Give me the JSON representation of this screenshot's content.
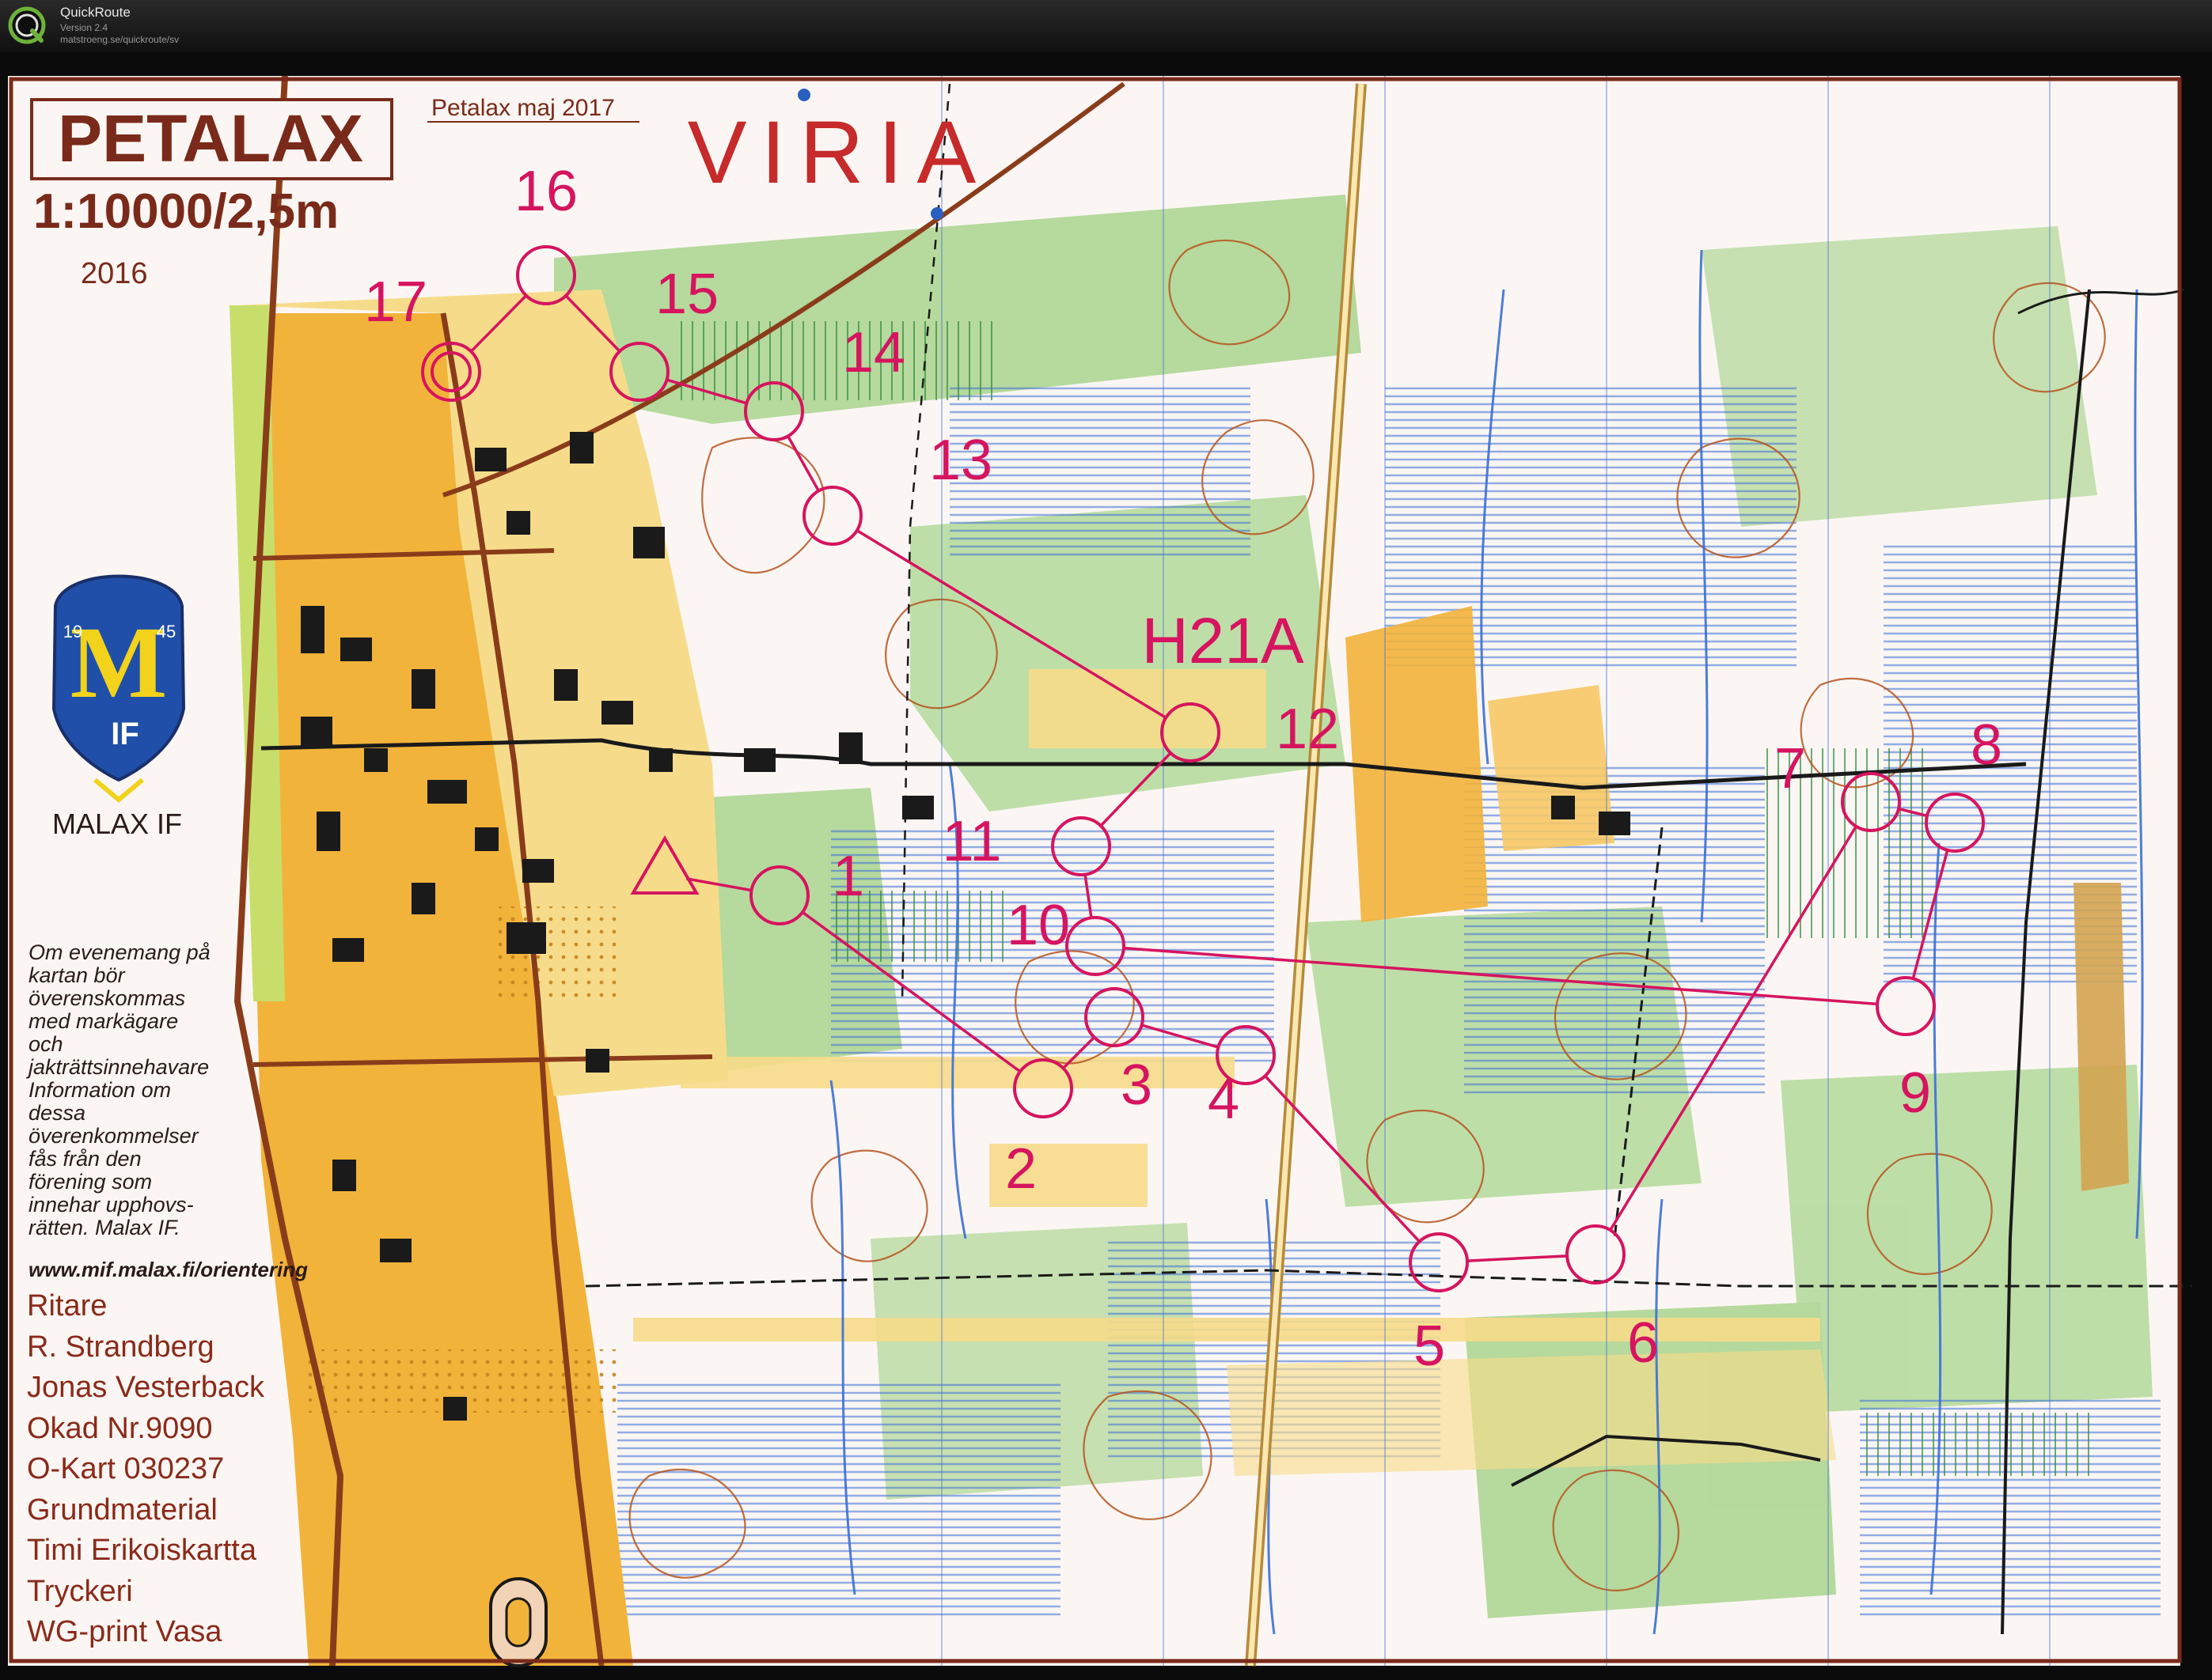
{
  "app": {
    "name": "QuickRoute",
    "version": "Version 2.4",
    "url": "matstroeng.se/quickroute/sv"
  },
  "map": {
    "title": "PETALAX",
    "event": "Petalax maj 2017",
    "scale": "1:10000/2,5m",
    "year": "2016",
    "sponsor": "VIRIA",
    "club": "MALAX IF",
    "logo": {
      "year_left": "19",
      "year_right": "45",
      "letter": "M",
      "initials": "IF"
    },
    "course": "H21A",
    "info_lines": [
      "Om evenemang på",
      "kartan bör",
      "överenskommas",
      "med markägare",
      "och",
      "jakträttsinnehavare",
      "Information om",
      "dessa",
      "överenkommelser",
      "fås från den",
      "förening som",
      "innehar upphovs-",
      "rätten. Malax IF."
    ],
    "website": "www.mif.malax.fi/orientering",
    "credits": [
      "Ritare",
      "R. Strandberg",
      "Jonas Vesterback",
      "Okad Nr.9090",
      "O-Kart 030237",
      "Grundmaterial",
      "Timi Erikoiskartta",
      "Tryckeri",
      "WG-print Vasa"
    ],
    "controls": [
      {
        "label": "1"
      },
      {
        "label": "2"
      },
      {
        "label": "3"
      },
      {
        "label": "4"
      },
      {
        "label": "5"
      },
      {
        "label": "6"
      },
      {
        "label": "7"
      },
      {
        "label": "8"
      },
      {
        "label": "9"
      },
      {
        "label": "10"
      },
      {
        "label": "11"
      },
      {
        "label": "12"
      },
      {
        "label": "13"
      },
      {
        "label": "14"
      },
      {
        "label": "15"
      },
      {
        "label": "16"
      },
      {
        "label": "17"
      }
    ],
    "colors": {
      "course": "#d6145f",
      "paper": "#fbf6f3",
      "forest_green": "#9fcf84",
      "open_yellow": "#f2b33a",
      "light_yellow": "#f6dc8a",
      "marsh_blue": "#3b6fd6",
      "contour_brown": "#b5531f",
      "sponsor_red": "#c62a2a"
    }
  }
}
